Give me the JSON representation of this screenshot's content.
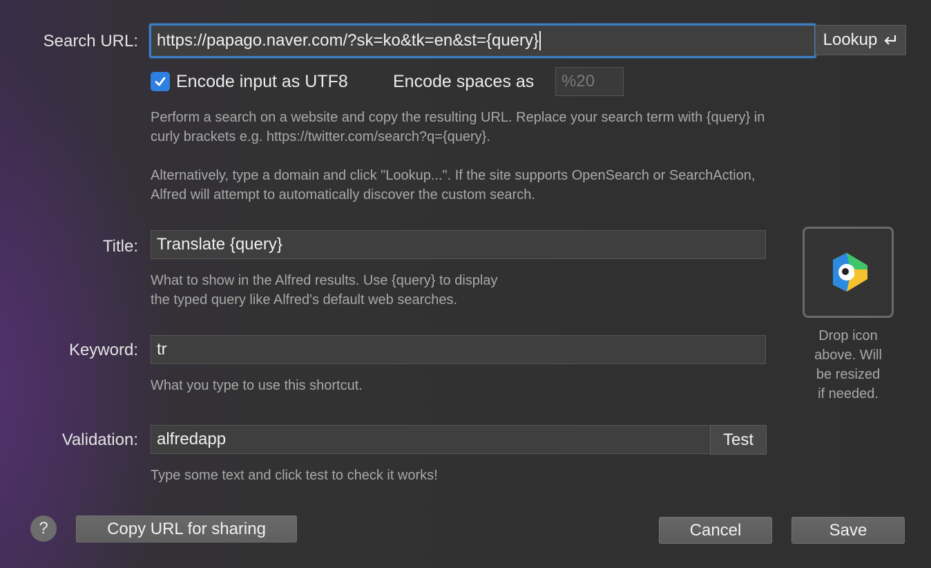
{
  "search_url": {
    "label": "Search URL:",
    "value": "https://papago.naver.com/?sk=ko&tk=en&st={query}",
    "lookup_label": "Lookup",
    "lookup_icon": "return-arrow-icon"
  },
  "encoding": {
    "utf8_label": "Encode input as UTF8",
    "utf8_checked": true,
    "spaces_label": "Encode spaces as",
    "spaces_placeholder": "%20"
  },
  "description": {
    "line1": "Perform a search on a website and copy the resulting URL. Replace your search term with {query} in",
    "line2": "curly brackets e.g. https://twitter.com/search?q={query}.",
    "line3": "Alternatively, type a domain and click \"Lookup...\". If the site supports OpenSearch or SearchAction,",
    "line4": "Alfred will attempt to automatically discover the custom search."
  },
  "title_field": {
    "label": "Title:",
    "value": "Translate {query}",
    "help_line1": "What to show in the Alfred results. Use {query} to display",
    "help_line2": "the typed query like Alfred's default web searches."
  },
  "keyword_field": {
    "label": "Keyword:",
    "value": "tr",
    "help": "What you type to use this shortcut."
  },
  "validation_field": {
    "label": "Validation:",
    "value": "alfredapp",
    "test_label": "Test",
    "help": "Type some text and click test to check it works!"
  },
  "icon_drop": {
    "icon": "papago-parrot-icon",
    "line1": "Drop icon",
    "line2": "above. Will",
    "line3": "be resized",
    "line4": "if needed."
  },
  "footer": {
    "help_symbol": "?",
    "copy_label": "Copy URL for sharing",
    "cancel_label": "Cancel",
    "save_label": "Save"
  },
  "colors": {
    "accent": "#2e7fe0",
    "focus_ring": "#3c7fc4",
    "papago_blue": "#2c8be0",
    "papago_green": "#3fc56b",
    "papago_yellow": "#f6c22e"
  }
}
